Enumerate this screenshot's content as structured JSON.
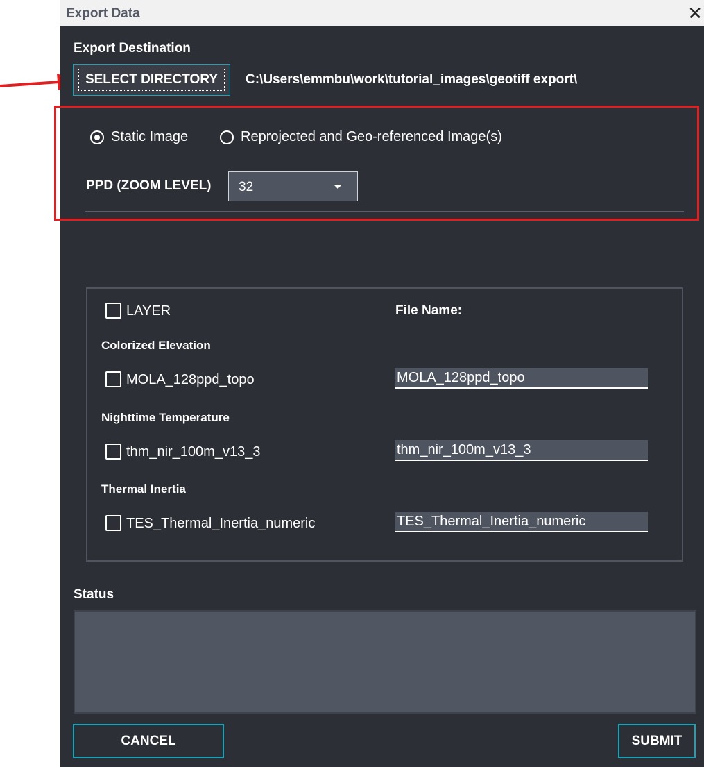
{
  "window": {
    "title": "Export Data",
    "close_icon": "close-icon"
  },
  "destination": {
    "heading": "Export Destination",
    "select_label": "SELECT DIRECTORY",
    "path": "C:\\Users\\emmbu\\work\\tutorial_images\\geotiff export\\"
  },
  "image_type": {
    "options": [
      {
        "label": "Static Image",
        "selected": true
      },
      {
        "label": "Reprojected and Geo-referenced Image(s)",
        "selected": false
      }
    ]
  },
  "ppd": {
    "label": "PPD (ZOOM LEVEL)",
    "value": "32"
  },
  "layers": {
    "header_checkbox_label": "LAYER",
    "file_name_header": "File Name:",
    "groups": [
      {
        "title": "Colorized Elevation",
        "layer": "MOLA_128ppd_topo",
        "file_name": "MOLA_128ppd_topo",
        "checked": false
      },
      {
        "title": "Nighttime Temperature",
        "layer": "thm_nir_100m_v13_3",
        "file_name": "thm_nir_100m_v13_3",
        "checked": false
      },
      {
        "title": "Thermal Inertia",
        "layer": "TES_Thermal_Inertia_numeric",
        "file_name": "TES_Thermal_Inertia_numeric",
        "checked": false
      }
    ]
  },
  "status": {
    "label": "Status",
    "text": ""
  },
  "buttons": {
    "cancel": "CANCEL",
    "submit": "SUBMIT"
  },
  "colors": {
    "accent": "#1aa3b8",
    "highlight": "#e02020",
    "background": "#2c2f36"
  }
}
